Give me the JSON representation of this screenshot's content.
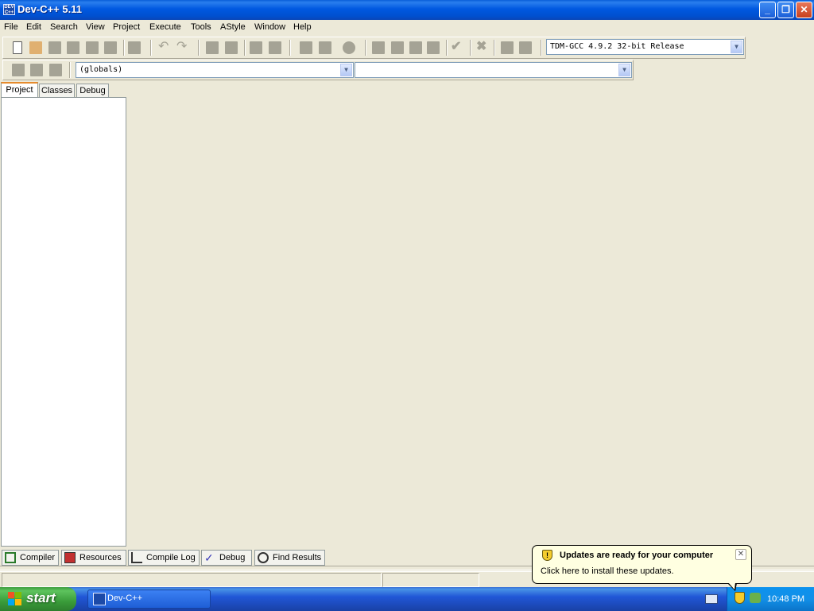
{
  "window": {
    "title": "Dev-C++ 5.11",
    "app_icon_text": "DEV\nC++"
  },
  "menu": [
    "File",
    "Edit",
    "Search",
    "View",
    "Project",
    "Execute",
    "Tools",
    "AStyle",
    "Window",
    "Help"
  ],
  "toolbar": {
    "compiler_select": "TDM-GCC 4.9.2 32-bit Release",
    "class_select": "(globals)",
    "member_select": ""
  },
  "side_tabs": [
    "Project",
    "Classes",
    "Debug"
  ],
  "bottom_tabs": [
    "Compiler",
    "Resources",
    "Compile Log",
    "Debug",
    "Find Results"
  ],
  "taskbar": {
    "start_label": "start",
    "task_label": "Dev-C++",
    "clock": "10:48 PM"
  },
  "balloon": {
    "title": "Updates are ready for your computer",
    "body": "Click here to install these updates."
  },
  "colors": {
    "titlebar": "#0058e0",
    "face": "#ece9d8",
    "balloon_bg": "#ffffe1",
    "start_green": "#3a9c3a"
  }
}
